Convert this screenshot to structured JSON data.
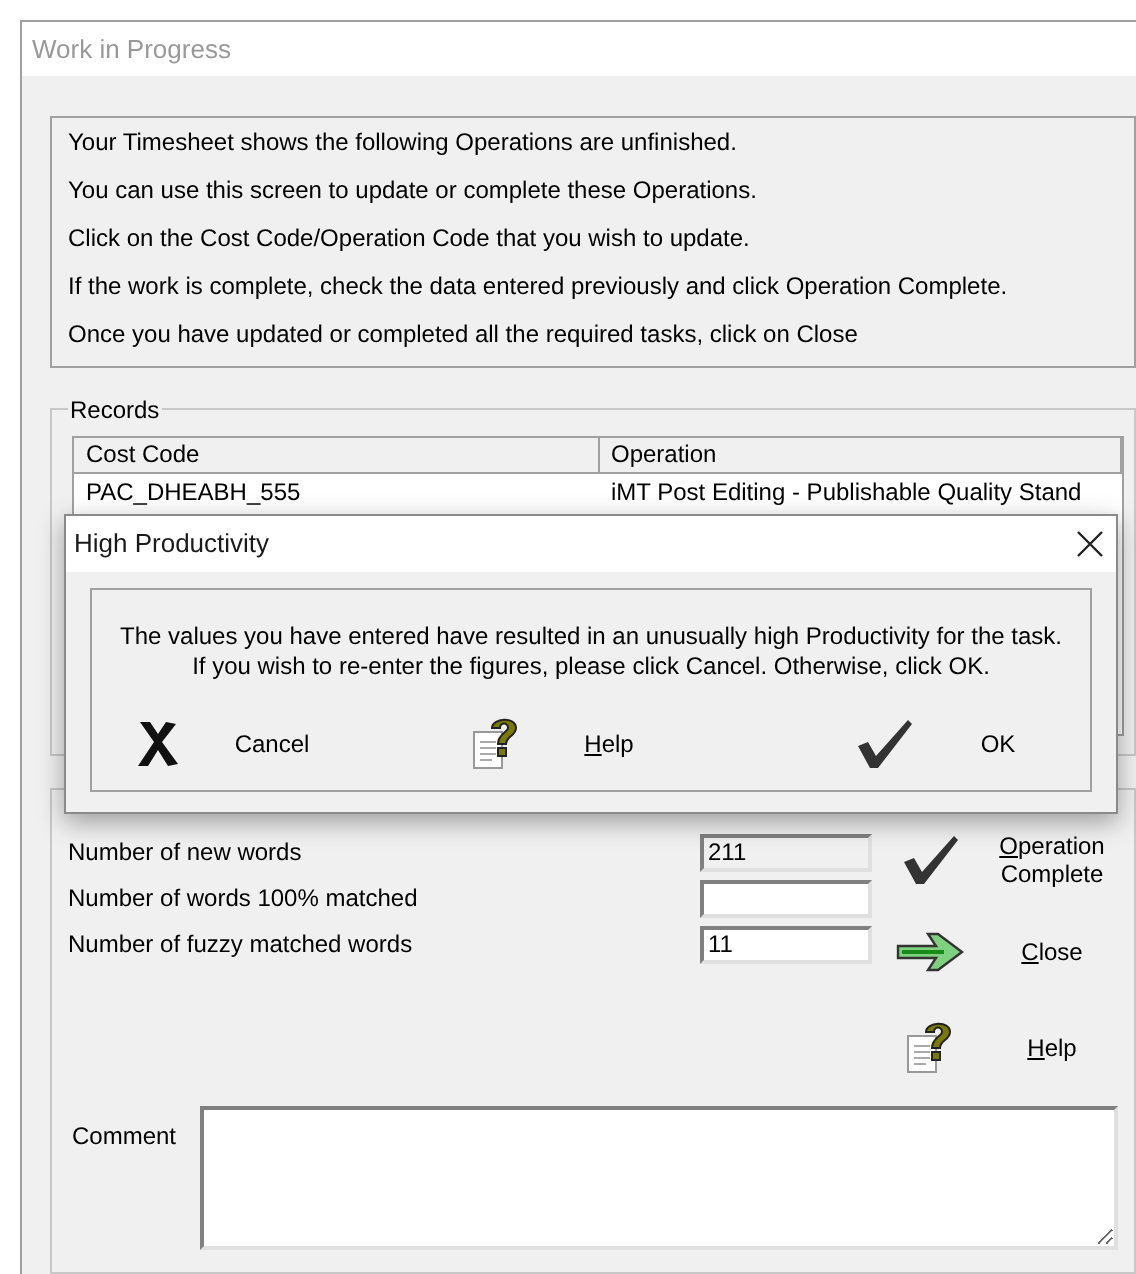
{
  "window": {
    "title": "Work in Progress"
  },
  "instructions": [
    "Your Timesheet shows the following Operations are unfinished.",
    "You can use this screen to update or complete these Operations.",
    "Click on the Cost Code/Operation Code that you wish to update.",
    "If the work is complete, check the data entered previously and click Operation Complete.",
    "Once you have updated or completed all the required tasks, click on Close"
  ],
  "records": {
    "label": "Records",
    "columns": [
      "Cost Code",
      "Operation"
    ],
    "rows": [
      [
        "PAC_DHEABH_555",
        "iMT Post Editing - Publishable Quality Stand"
      ]
    ]
  },
  "fields": [
    {
      "label": "Number of new words",
      "value": "211",
      "disabled": true
    },
    {
      "label": "Number of words 100% matched",
      "disabled": false
    },
    {
      "label": "Number of fuzzy matched words",
      "value": "11",
      "disabled": false
    }
  ],
  "actions": [
    {
      "kind": "complete",
      "label": "Operation Complete"
    },
    {
      "kind": "close",
      "label": "Close"
    },
    {
      "kind": "help",
      "label": "Help"
    }
  ],
  "comment": {
    "label": "Comment"
  },
  "dialog": {
    "title": "High Productivity",
    "message": [
      "The values you have entered have resulted in an unusually high Productivity for the task.",
      "If you wish to re-enter the figures, please click Cancel. Otherwise, click OK."
    ],
    "buttons": [
      {
        "kind": "cancel",
        "label": "Cancel"
      },
      {
        "kind": "help",
        "label": "Help"
      },
      {
        "kind": "ok",
        "label": "OK"
      }
    ]
  }
}
